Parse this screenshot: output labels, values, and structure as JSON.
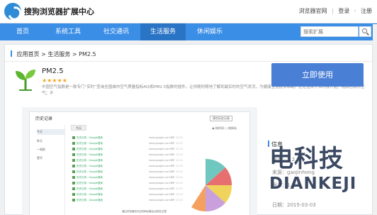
{
  "header": {
    "site_title": "搜狗浏览器扩展中心",
    "links": {
      "official": "浏览器官网",
      "login": "登录",
      "sep": "·",
      "register": "注册"
    }
  },
  "nav": {
    "items": [
      {
        "label": "首页"
      },
      {
        "label": "系统工具"
      },
      {
        "label": "社交通讯"
      },
      {
        "label": "生活服务"
      },
      {
        "label": "休闲娱乐"
      }
    ],
    "active": "生活服务",
    "search_placeholder": "搜索扩展"
  },
  "breadcrumb": {
    "home": "应用首页",
    "sep1": " > ",
    "category": "生活服务",
    "sep2": " > ",
    "current": "PM2.5"
  },
  "app": {
    "name": "PM2.5",
    "rating": "★★★★★",
    "description": "中国空气指数是一款专门“实时”查询全国城市空气质量指标AQI和PM2.5指数的插件。让你随时随地了解到最实时的空气状况，为健康生活提供帮助。还记住从什么时候开始，用颜色表示空气；不"
  },
  "preview": {
    "title": "历史记录",
    "clear": "清空历史记录",
    "sidebar": [
      "今天",
      "昨天",
      "一周前",
      "更早"
    ],
    "tab": "今天",
    "options": "◉ 按时间  ○ 按网站",
    "row_site": "历史记录 - Google搜索",
    "row_url": "www.google.com.hk",
    "row_time": "下午 10:12",
    "footer": "通过浏览器访问过的网站都会出现在这里"
  },
  "sidebar": {
    "install_label": "立即使用",
    "info_title": "信息",
    "info": [
      {
        "label": "版本：2.2.2"
      },
      {
        "label": "来源：gaojinhong"
      },
      {
        "label": "版本：1.1.1"
      },
      {
        "label": "日期：2015-03-03"
      }
    ]
  },
  "watermark": {
    "cn": "电科技",
    "en": "DIANKEJI"
  },
  "colors": {
    "nav": "#3a8ee6",
    "nav_active": "#2a74c6",
    "button": "#4a7fd6",
    "star": "#f5a623"
  }
}
